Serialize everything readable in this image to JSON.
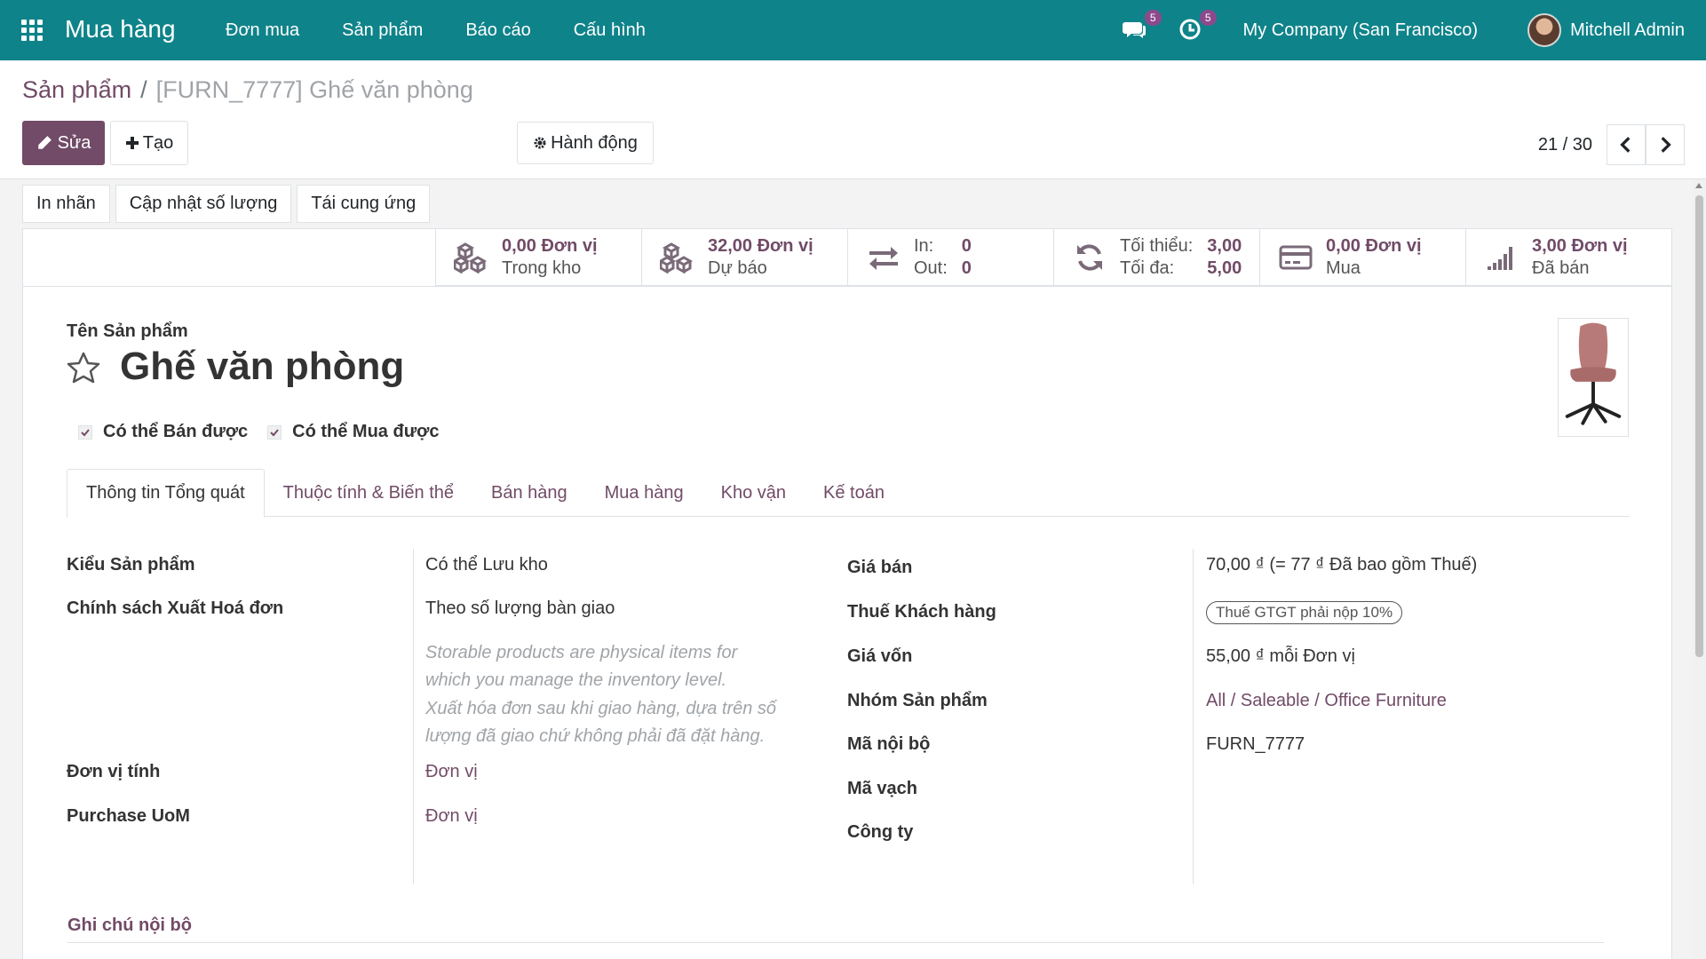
{
  "navbar": {
    "app_name": "Mua hàng",
    "menu": [
      "Đơn mua",
      "Sản phẩm",
      "Báo cáo",
      "Cấu hình"
    ],
    "messages_count": "5",
    "activities_count": "5",
    "company": "My Company (San Francisco)",
    "user": "Mitchell Admin",
    "icons": [
      "apps-grid-icon",
      "chat-icon",
      "clock-activity-icon"
    ]
  },
  "breadcrumb": {
    "parent": "Sản phẩm",
    "separator": "/",
    "current": "[FURN_7777] Ghế văn phòng"
  },
  "toolbar": {
    "edit_label": "Sửa",
    "create_label": "Tạo",
    "action_label": "Hành động"
  },
  "pager": {
    "value": "21 / 30"
  },
  "header_buttons": [
    "In nhãn",
    "Cập nhật số lượng",
    "Tái cung ứng"
  ],
  "smart_buttons": {
    "on_hand": {
      "value": "0,00 Đơn vị",
      "label": "Trong kho"
    },
    "forecast": {
      "value": "32,00 Đơn vị",
      "label": "Dự báo"
    },
    "in_out": {
      "in_label": "In:",
      "in_value": "0",
      "out_label": "Out:",
      "out_value": "0"
    },
    "minmax": {
      "min_label": "Tối thiểu:",
      "min_value": "3,00",
      "max_label": "Tối đa:",
      "max_value": "5,00"
    },
    "purchased": {
      "value": "0,00 Đơn vị",
      "label": "Mua"
    },
    "sold": {
      "value": "3,00 Đơn vị",
      "label": "Đã bán"
    }
  },
  "product": {
    "name_label": "Tên Sản phẩm",
    "name": "Ghế văn phòng",
    "can_be_sold": "Có thể Bán được",
    "can_be_purchased": "Có thể Mua được"
  },
  "tabs": [
    "Thông tin Tổng quát",
    "Thuộc tính & Biến thể",
    "Bán hàng",
    "Mua hàng",
    "Kho vận",
    "Kế toán"
  ],
  "general": {
    "type_label": "Kiểu Sản phẩm",
    "type_value": "Có thể Lưu kho",
    "invoice_policy_label": "Chính sách Xuất Hoá đơn",
    "invoice_policy_value": "Theo số lượng bàn giao",
    "help_storable_1": "Storable products are physical items for",
    "help_storable_2": "which you manage the inventory level.",
    "help_invoice_1": "Xuất hóa đơn sau khi giao hàng, dựa trên số",
    "help_invoice_2": "lượng đã giao chứ không phải đã đặt hàng.",
    "uom_label": "Đơn vị tính",
    "uom_value": "Đơn vị",
    "purchase_uom_label": "Purchase UoM",
    "purchase_uom_value": "Đơn vị",
    "sales_price_label": "Giá bán",
    "sales_price_value": "70,00 ₫  (= 77 ₫ Đã bao gồm Thuế)",
    "customer_tax_label": "Thuế Khách hàng",
    "customer_tax_value": "Thuế GTGT phải nộp 10%",
    "cost_label": "Giá vốn",
    "cost_value": "55,00 ₫  mỗi Đơn vị",
    "category_label": "Nhóm Sản phẩm",
    "category_value": "All / Saleable / Office Furniture",
    "internal_ref_label": "Mã nội bộ",
    "internal_ref_value": "FURN_7777",
    "barcode_label": "Mã vạch",
    "company_label": "Công ty"
  },
  "notes": {
    "label": "Ghi chú nội bộ"
  },
  "colors": {
    "navbar": "#0f838a",
    "primary": "#714b67",
    "badge": "#8c4a8d"
  }
}
